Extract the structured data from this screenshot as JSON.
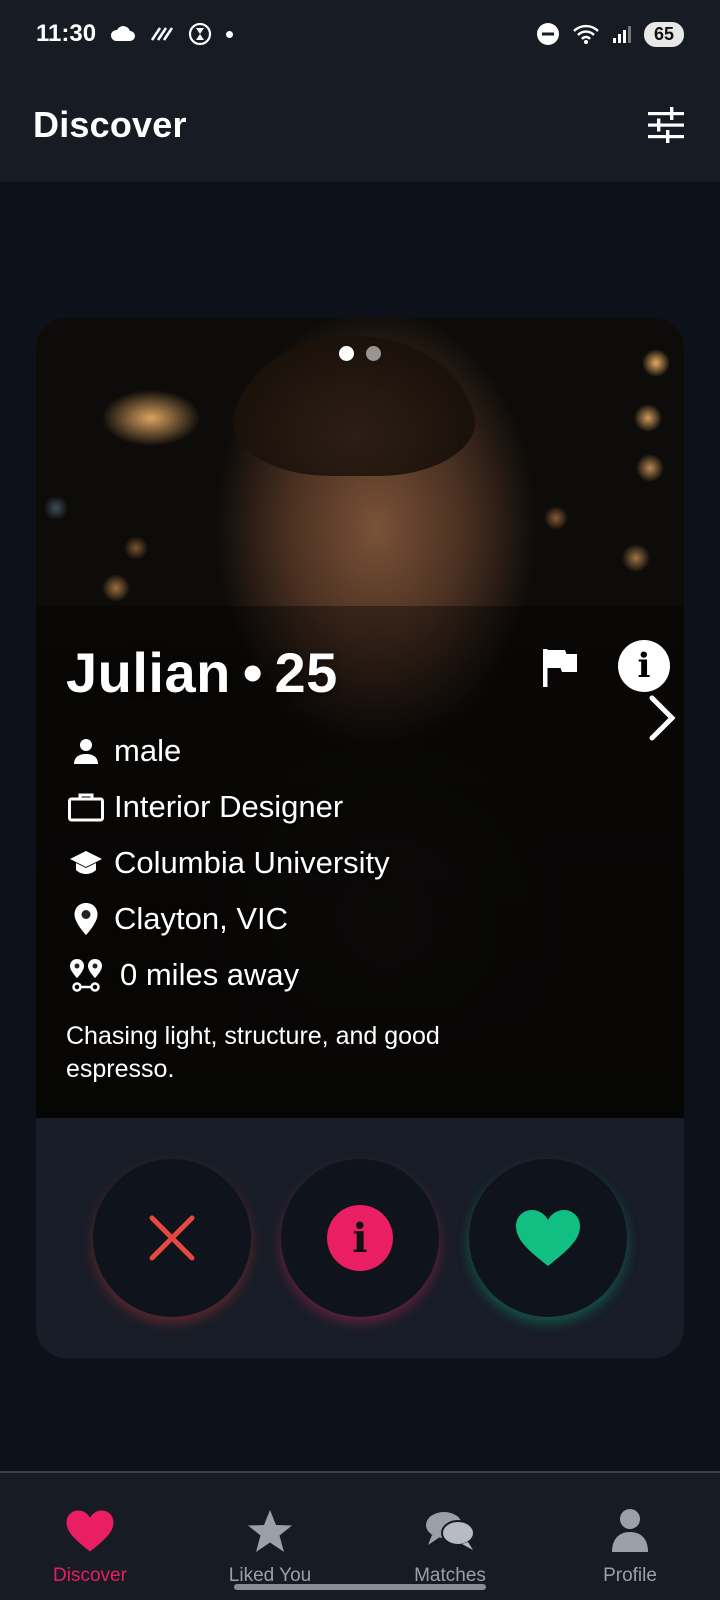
{
  "status_bar": {
    "time": "11:30",
    "battery": "65",
    "icons": [
      "cloud-icon",
      "data-saver-icon",
      "hourglass-icon",
      "dot-icon",
      "dnd-icon",
      "wifi-icon",
      "signal-icon"
    ]
  },
  "header": {
    "title": "Discover",
    "filter_icon": "sliders-icon"
  },
  "profile": {
    "name": "Julian",
    "separator": "•",
    "age": "25",
    "photo_count": 2,
    "active_photo": 1,
    "gender": "male",
    "job": "Interior Designer",
    "school": "Columbia University",
    "location": "Clayton, VIC",
    "distance": "0 miles away",
    "bio": "Chasing light, structure, and good espresso."
  },
  "actions": {
    "reject_icon": "close-icon",
    "info_icon": "info-icon",
    "like_icon": "heart-icon"
  },
  "nav": {
    "items": [
      {
        "label": "Discover",
        "icon": "heart-icon",
        "active": true
      },
      {
        "label": "Liked You",
        "icon": "star-icon",
        "active": false
      },
      {
        "label": "Matches",
        "icon": "chat-icon",
        "active": false
      },
      {
        "label": "Profile",
        "icon": "user-icon",
        "active": false
      }
    ]
  },
  "colors": {
    "background": "#0d1119",
    "surface": "#161b24",
    "card": "#181d27",
    "accent_pink": "#e91e63",
    "reject_red": "#e5483f",
    "like_green": "#12bf82",
    "inactive_nav": "#9aa0a8"
  }
}
